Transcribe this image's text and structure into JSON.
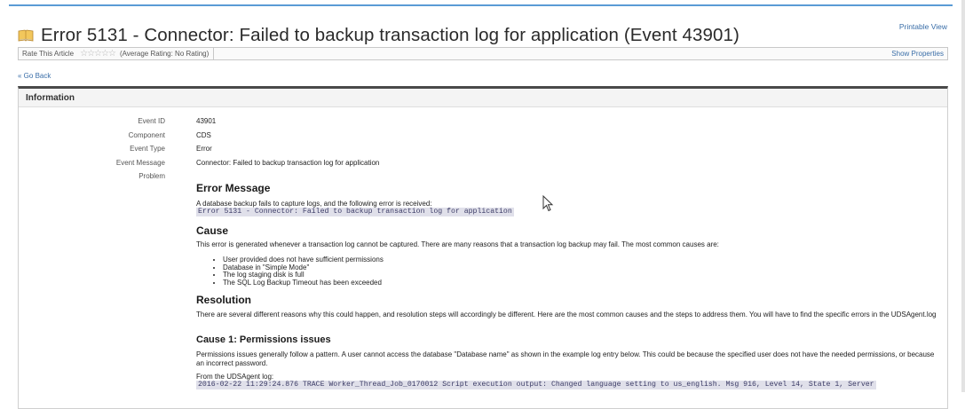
{
  "title": "Error 5131 - Connector: Failed to backup transaction log for application (Event 43901)",
  "printable_view": "Printable View",
  "rating": {
    "label": "Rate This Article",
    "stars": "☆☆☆☆☆",
    "average": "(Average Rating: No Rating)",
    "show_properties": "Show Properties"
  },
  "go_back": "« Go Back",
  "panel": {
    "header": "Information",
    "fields": [
      {
        "label": "Event ID",
        "value": "43901"
      },
      {
        "label": "Component",
        "value": "CDS"
      },
      {
        "label": "Event Type",
        "value": "Error"
      },
      {
        "label": "Event Message",
        "value": "Connector: Failed to backup transaction log for application"
      },
      {
        "label": "Problem",
        "value": ""
      }
    ]
  },
  "problem": {
    "error_heading": "Error Message",
    "error_intro": "A database backup fails to capture logs, and the following error is received:",
    "error_code": "Error 5131 - Connector: Failed to backup transaction log for application",
    "cause_heading": "Cause",
    "cause_text": "This error is generated whenever a transaction log cannot be captured. There are many reasons that a transaction log backup may fail.  The most common causes are:",
    "causes": [
      "User provided does not have sufficient permissions",
      "Database in \"Simple Mode\"",
      "The log staging disk is full",
      "The SQL Log Backup Timeout has been exceeded"
    ],
    "resolution_heading": "Resolution",
    "resolution_text": "There are several  different reasons why this could happen, and resolution steps will accordingly be different. Here are the most common causes and the steps to address them.  You will have to find the specific errors in the UDSAgent.log",
    "cause1_heading": "Cause 1: Permissions issues",
    "cause1_text": "Permissions issues generally follow a pattern.  A user cannot access the database \"Database name\" as shown in the example log entry below.  This could be because the specified user does not have the needed permissions, or because an incorrect password.",
    "log_label": "From the UDSAgent log:",
    "log_line": "2016-02-22 11:29:24.876 TRACE Worker_Thread_Job_0170012 Script execution output: Changed language setting to us_english. Msg 916, Level 14, State 1, Server"
  },
  "colors": {
    "accent": "#5a9bd5",
    "link": "#3a6ea8",
    "header_bar": "#4a4a4a"
  },
  "icons": [
    "book-icon",
    "star-icon",
    "mouse-cursor-icon"
  ]
}
